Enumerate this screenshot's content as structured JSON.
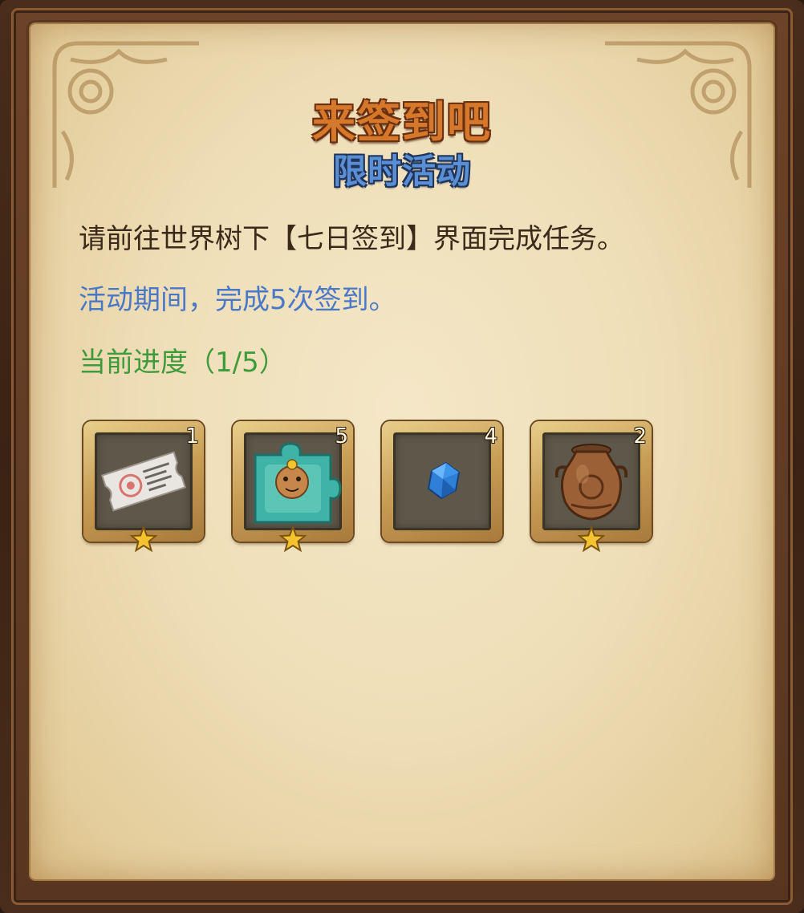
{
  "header": {
    "title": "来签到吧",
    "subtitle": "限时活动"
  },
  "body": {
    "description": "请前往世界树下【七日签到】界面完成任务。",
    "condition": "活动期间，完成5次签到。",
    "progress": "当前进度（1/5）"
  },
  "rewards": [
    {
      "icon": "ticket-icon",
      "count": "1",
      "starred": true
    },
    {
      "icon": "puzzle-piece-icon",
      "count": "5",
      "starred": true
    },
    {
      "icon": "blue-crystal-icon",
      "count": "4",
      "starred": false
    },
    {
      "icon": "vase-icon",
      "count": "2",
      "starred": true
    }
  ],
  "colors": {
    "title": "#d6782b",
    "subtitle": "#5a8fd6",
    "condition": "#4a78c9",
    "progress": "#3f9a3c",
    "text": "#3b2a1a"
  }
}
